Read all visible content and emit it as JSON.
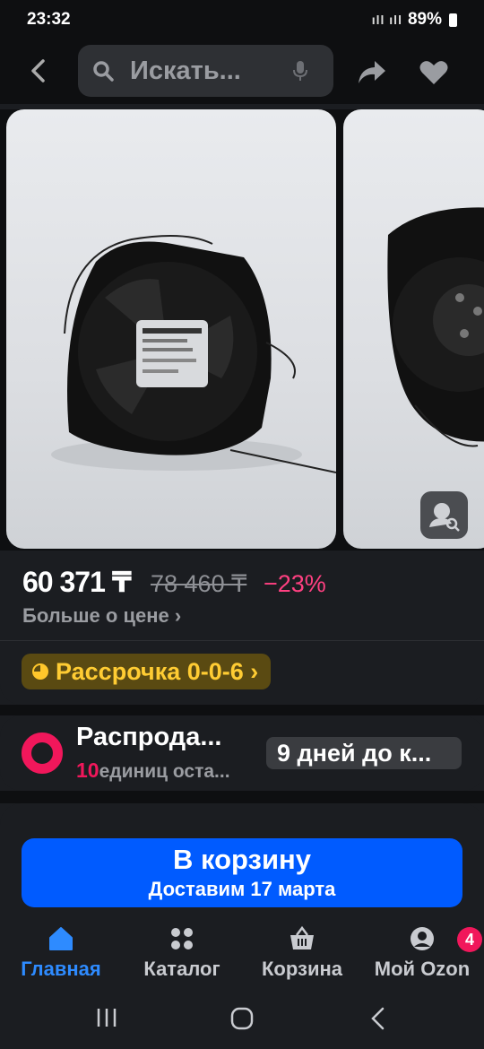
{
  "status_bar": {
    "time": "23:32",
    "signal": "ıll ıll",
    "battery": "89%"
  },
  "top_bar": {
    "search_placeholder": "Искать..."
  },
  "gallery": {
    "photo_count": 2
  },
  "product": {
    "price": "60 371 ₸",
    "old_price": "78 460 ₸",
    "discount": "−23%",
    "more_about_price": "Больше о цене ›",
    "installment": "Рассрочка 0-0-6 ›"
  },
  "sale": {
    "title": "Распрода...",
    "count": "10",
    "count_text": "единиц оста...",
    "timer": "9 дней до к..."
  },
  "cta": {
    "label": "В корзину",
    "delivery": "Доставим 17 марта"
  },
  "bottom_nav": {
    "items": [
      {
        "label": "Главная",
        "icon": "home-icon",
        "active": true
      },
      {
        "label": "Каталог",
        "icon": "grid-icon",
        "active": false
      },
      {
        "label": "Корзина",
        "icon": "basket-icon",
        "active": false
      },
      {
        "label": "Мой Ozon",
        "icon": "profile-icon",
        "active": false,
        "badge": "4"
      }
    ]
  },
  "colors": {
    "accent_blue": "#005bff",
    "sale_pink": "#f1175b",
    "installment_yellow": "#ffcc33"
  }
}
